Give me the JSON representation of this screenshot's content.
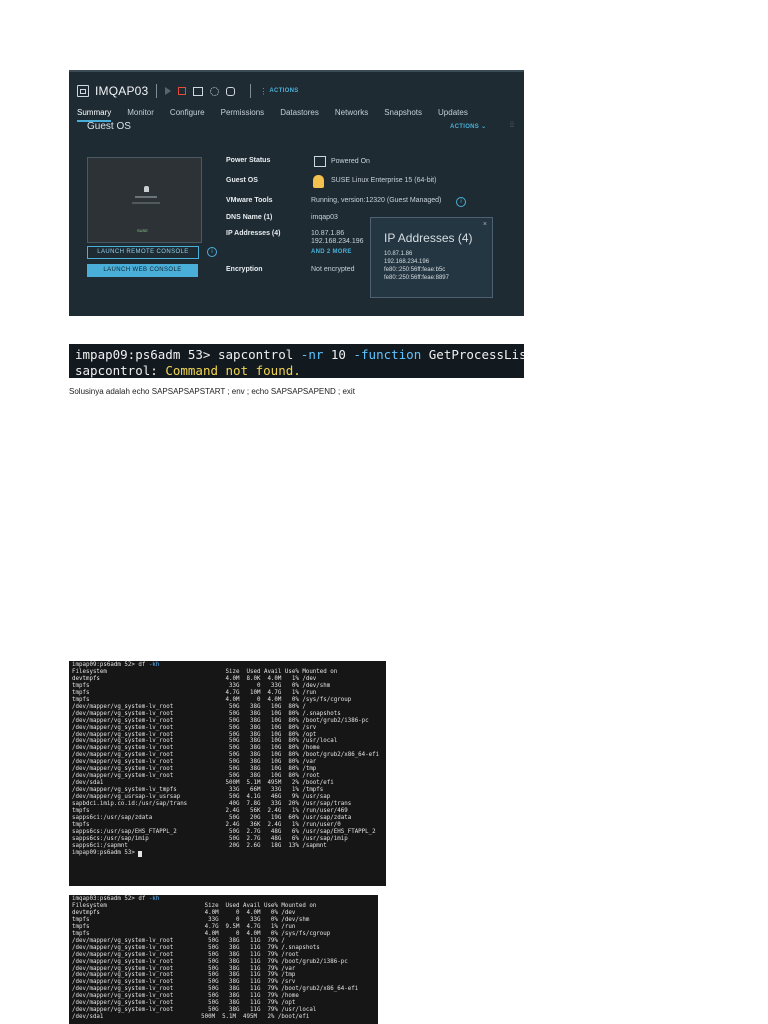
{
  "vsphere": {
    "vm_name": "IMQAP03",
    "actions_label": "ACTIONS",
    "tabs": [
      "Summary",
      "Monitor",
      "Configure",
      "Permissions",
      "Datastores",
      "Networks",
      "Snapshots",
      "Updates"
    ],
    "active_tab": "Summary",
    "section_title": "Guest OS",
    "section_actions": "ACTIONS ⌄",
    "launch_remote": "LAUNCH REMOTE CONSOLE",
    "launch_web": "LAUNCH WEB CONSOLE",
    "thumb_brand": "SUSE",
    "props": {
      "power_label": "Power Status",
      "power_value": "Powered On",
      "os_label": "Guest OS",
      "os_value": "SUSE Linux Enterprise 15 (64-bit)",
      "tools_label": "VMware Tools",
      "tools_value": "Running, version:12320 (Guest Managed)",
      "dns_label": "DNS Name (1)",
      "dns_value": "imqap03",
      "ip_label": "IP Addresses (4)",
      "ip_value_1": "10.87.1.86",
      "ip_value_2": "192.168.234.196",
      "and_more": "AND 2 MORE",
      "enc_label": "Encryption",
      "enc_value": "Not encrypted"
    },
    "ip_popup": {
      "title": "IP Addresses (4)",
      "close": "×",
      "lines": [
        "10.87.1.86",
        "192.168.234.196",
        "fe80::250:56ff:feae:b5c",
        "fe80::250:56ff:feae:8897"
      ]
    },
    "accent_color": "#49afd9",
    "stop_color": "#e64a3c"
  },
  "cmd_terminal": {
    "prompt": "impap09:ps6adm 53>",
    "command": "sapcontrol",
    "arg1": "-nr",
    "arg1_val": "10",
    "arg2": "-function",
    "arg2_val": "GetProcessList",
    "error_prefix": "sapcontrol:",
    "error_msg": "Command not found."
  },
  "solution_text": "Solusinya adalah echo SAPSAPSAPSTART ; env ; echo SAPSAPSAPEND ; exit",
  "df_terminal_1": {
    "prompt": "impap09:ps6adm 52>",
    "command": "df",
    "flag": "-kh",
    "lines": [
      "Filesystem                                  Size  Used Avail Use% Mounted on",
      "devtmpfs                                    4.0M  8.0K  4.0M   1% /dev",
      "tmpfs                                        33G     0   33G   0% /dev/shm",
      "tmpfs                                       4.7G   10M  4.7G   1% /run",
      "tmpfs                                       4.0M     0  4.0M   0% /sys/fs/cgroup",
      "/dev/mapper/vg_system-lv_root                50G   38G   10G  80% /",
      "/dev/mapper/vg_system-lv_root                50G   38G   10G  80% /.snapshots",
      "/dev/mapper/vg_system-lv_root                50G   38G   10G  80% /boot/grub2/i386-pc",
      "/dev/mapper/vg_system-lv_root                50G   38G   10G  80% /srv",
      "/dev/mapper/vg_system-lv_root                50G   38G   10G  80% /opt",
      "/dev/mapper/vg_system-lv_root                50G   38G   10G  80% /usr/local",
      "/dev/mapper/vg_system-lv_root                50G   38G   10G  80% /home",
      "/dev/mapper/vg_system-lv_root                50G   38G   10G  80% /boot/grub2/x86_64-efi",
      "/dev/mapper/vg_system-lv_root                50G   38G   10G  80% /var",
      "/dev/mapper/vg_system-lv_root                50G   38G   10G  80% /tmp",
      "/dev/mapper/vg_system-lv_root                50G   38G   10G  80% /root",
      "/dev/sda1                                   500M  5.1M  495M   2% /boot/efi",
      "/dev/mapper/vg_system-lv_tmpfs               33G   66M   33G   1% /tmpfs",
      "/dev/mapper/vg_usrsap-lv_usrsap              50G  4.1G   46G   9% /usr/sap",
      "sapbdci.imip.co.id:/usr/sap/trans            40G  7.8G   33G  20% /usr/sap/trans",
      "tmpfs                                       2.4G   56K  2.4G   1% /run/user/469",
      "sapps6ci:/usr/sap/zdata                      50G   20G   19G  60% /usr/sap/zdata",
      "tmpfs                                       2.4G   36K  2.4G   1% /run/user/0",
      "sapps6cs:/usr/sap/EHS_FTAPPL_2               50G  2.7G   48G   6% /usr/sap/EHS_FTAPPL_2",
      "sapps6cs:/usr/sap/imip                       50G  2.7G   48G   6% /usr/sap/imip",
      "sapps6ci:/sapmnt                             20G  2.6G   18G  13% /sapmnt"
    ],
    "final_prompt": "impap09:ps6adm 53>"
  },
  "df_terminal_2": {
    "prompt": "imqap03:ps6adm 52>",
    "command": "df",
    "flag": "-kh",
    "lines": [
      "Filesystem                            Size  Used Avail Use% Mounted on",
      "devtmpfs                              4.0M     0  4.0M   0% /dev",
      "tmpfs                                  33G     0   33G   0% /dev/shm",
      "tmpfs                                 4.7G  9.5M  4.7G   1% /run",
      "tmpfs                                 4.0M     0  4.0M   0% /sys/fs/cgroup",
      "/dev/mapper/vg_system-lv_root          50G   38G   11G  79% /",
      "/dev/mapper/vg_system-lv_root          50G   38G   11G  79% /.snapshots",
      "/dev/mapper/vg_system-lv_root          50G   38G   11G  79% /root",
      "/dev/mapper/vg_system-lv_root          50G   38G   11G  79% /boot/grub2/i386-pc",
      "/dev/mapper/vg_system-lv_root          50G   38G   11G  79% /var",
      "/dev/mapper/vg_system-lv_root          50G   38G   11G  79% /tmp",
      "/dev/mapper/vg_system-lv_root          50G   38G   11G  79% /srv",
      "/dev/mapper/vg_system-lv_root          50G   38G   11G  79% /boot/grub2/x86_64-efi",
      "/dev/mapper/vg_system-lv_root          50G   38G   11G  79% /home",
      "/dev/mapper/vg_system-lv_root          50G   38G   11G  79% /opt",
      "/dev/mapper/vg_system-lv_root          50G   38G   11G  79% /usr/local",
      "/dev/sda1                            500M  5.1M  495M   2% /boot/efi"
    ]
  }
}
